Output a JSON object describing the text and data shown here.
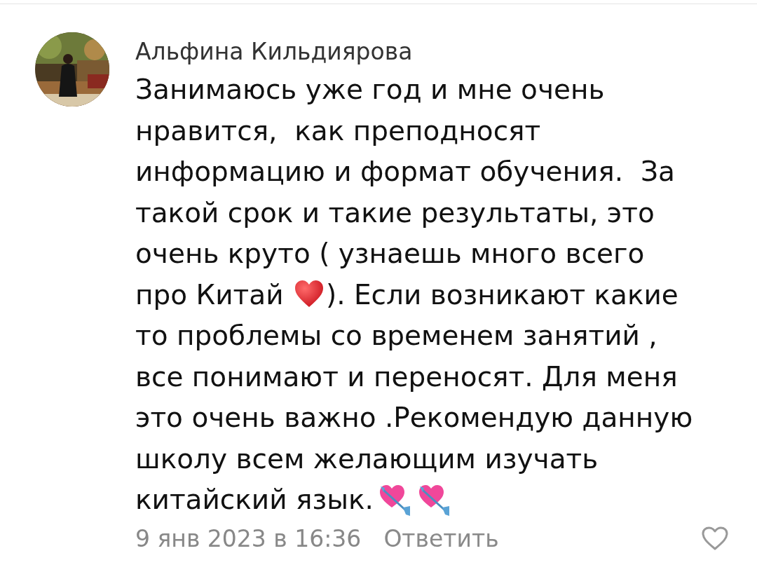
{
  "comment": {
    "author": "Альфина Кильдиярова",
    "lines": [
      [
        {
          "kind": "text",
          "text": "Занимаюсь уже год и мне очень"
        }
      ],
      [
        {
          "kind": "text",
          "text": "нравится,  как преподносят"
        }
      ],
      [
        {
          "kind": "text",
          "text": "информацию и формат обучения.  За"
        }
      ],
      [
        {
          "kind": "text",
          "text": "такой срок и такие результаты, это"
        }
      ],
      [
        {
          "kind": "text",
          "text": "очень круто ( узнаешь много всего"
        }
      ],
      [
        {
          "kind": "text",
          "text": "про Китай "
        },
        {
          "kind": "heart"
        },
        {
          "kind": "text",
          "text": "). Если возникают какие"
        }
      ],
      [
        {
          "kind": "text",
          "text": "то проблемы со временем занятий ,"
        }
      ],
      [
        {
          "kind": "text",
          "text": "все понимают и переносят. Для меня"
        }
      ],
      [
        {
          "kind": "text",
          "text": "это очень важно .Рекомендую данную"
        }
      ],
      [
        {
          "kind": "text",
          "text": "школу всем желающим изучать"
        }
      ],
      [
        {
          "kind": "text",
          "text": "китайский язык."
        },
        {
          "kind": "arrow-heart"
        },
        {
          "kind": "arrow-heart"
        }
      ]
    ],
    "date": "9 янв 2023 в 16:36",
    "reply": "Ответить",
    "liked": false
  }
}
